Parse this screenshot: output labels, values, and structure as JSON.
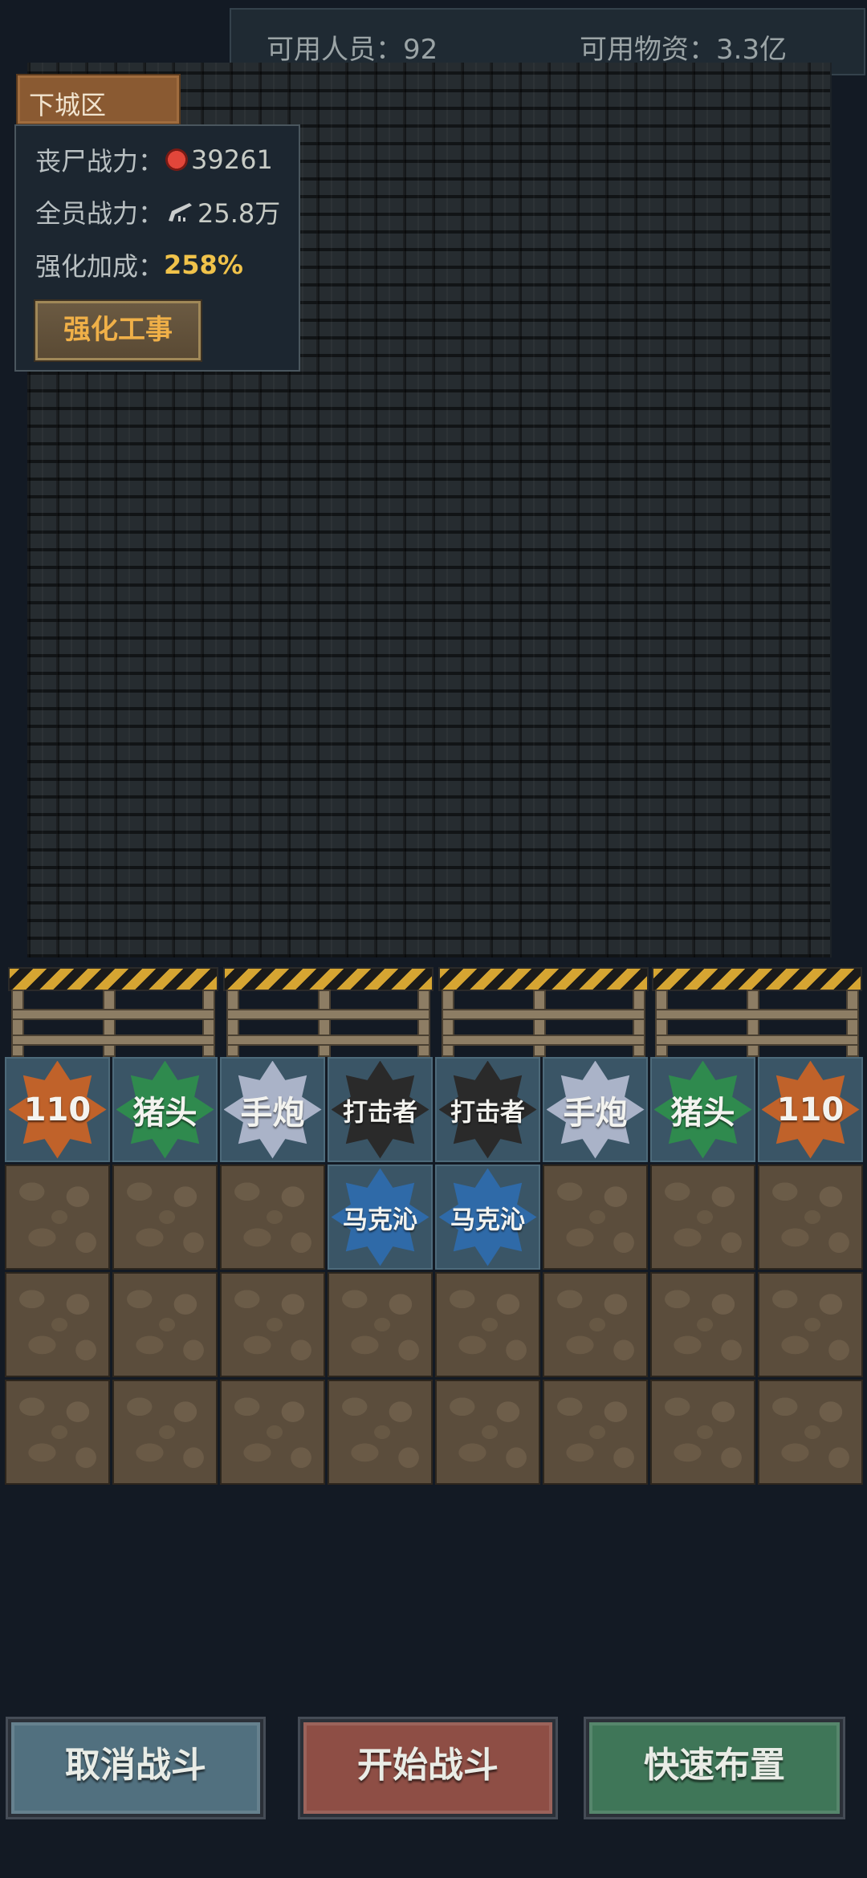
{
  "top_bar": {
    "available_people": "可用人员：92",
    "available_supplies": "可用物资：3.3亿"
  },
  "area": {
    "name": "下城区"
  },
  "stats": {
    "zombie_power_label": "丧尸战力：",
    "zombie_power_value": "39261",
    "team_power_label": "全员战力：",
    "team_power_value": "25.8万",
    "boost_label": "强化加成：",
    "boost_value": "258%",
    "upgrade_button": "强化工事"
  },
  "grid": {
    "row1": [
      {
        "label": "110",
        "color": "#c0622a",
        "size": "big"
      },
      {
        "label": "猪头",
        "color": "#2f8a4e",
        "size": "big"
      },
      {
        "label": "手炮",
        "color": "#aab3c8",
        "size": "big"
      },
      {
        "label": "打击者",
        "color": "#2a2a2a",
        "size": "small"
      },
      {
        "label": "打击者",
        "color": "#2a2a2a",
        "size": "small"
      },
      {
        "label": "手炮",
        "color": "#aab3c8",
        "size": "big"
      },
      {
        "label": "猪头",
        "color": "#2f8a4e",
        "size": "big"
      },
      {
        "label": "110",
        "color": "#c0622a",
        "size": "big"
      }
    ],
    "row2_units": [
      {
        "label": "马克沁",
        "color": "#2f6aa8"
      },
      {
        "label": "马克沁",
        "color": "#2f6aa8"
      }
    ]
  },
  "buttons": {
    "cancel": "取消战斗",
    "start": "开始战斗",
    "quick": "快速布置"
  },
  "colors": {
    "background": "#131a24",
    "accent_gold": "#f0c24a",
    "cancel_btn": "#51707f",
    "start_btn": "#8e4e45",
    "quick_btn": "#3f7658"
  }
}
